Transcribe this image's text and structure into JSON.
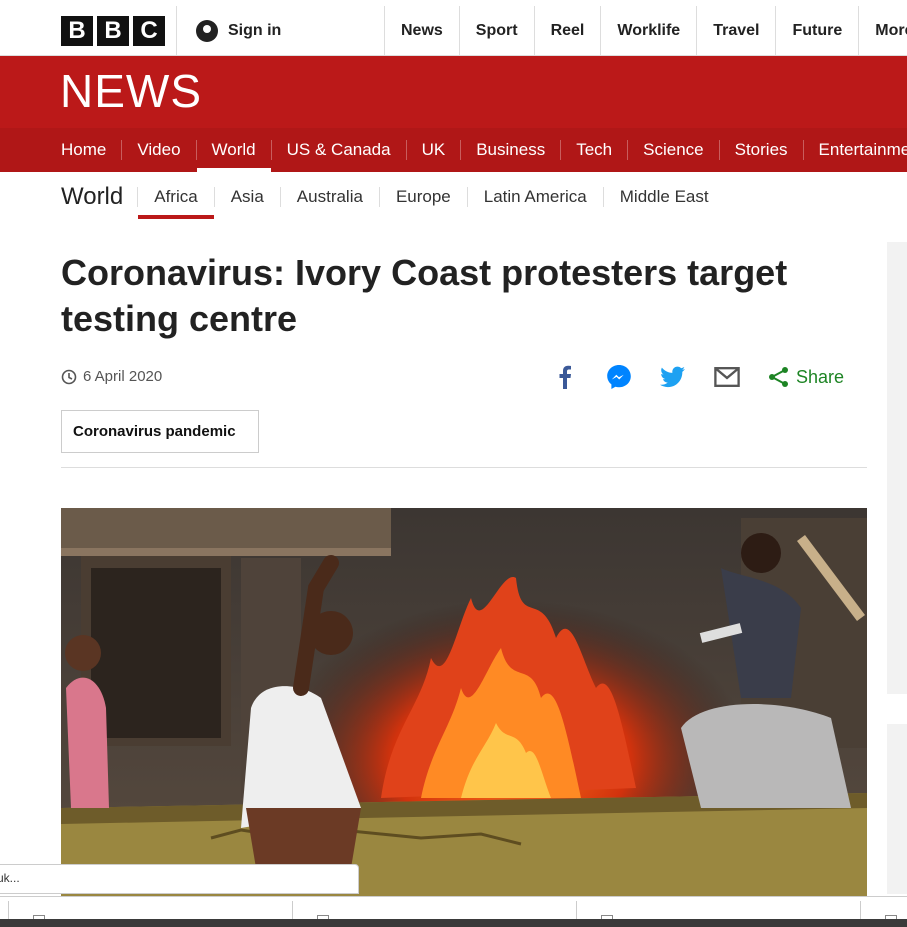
{
  "header": {
    "logo_letters": [
      "B",
      "B",
      "C"
    ],
    "sign_in": "Sign in",
    "nav": [
      "News",
      "Sport",
      "Reel",
      "Worklife",
      "Travel",
      "Future",
      "More"
    ]
  },
  "news_banner": {
    "title": "NEWS"
  },
  "section_nav": {
    "items": [
      "Home",
      "Video",
      "World",
      "US & Canada",
      "UK",
      "Business",
      "Tech",
      "Science",
      "Stories",
      "Entertainment"
    ],
    "active": "World"
  },
  "sub_nav": {
    "title": "World",
    "items": [
      "Africa",
      "Asia",
      "Australia",
      "Europe",
      "Latin America",
      "Middle East"
    ],
    "active": "Africa"
  },
  "article": {
    "headline": "Coronavirus: Ivory Coast protesters target testing centre",
    "date": "6 April 2020",
    "tag": "Coronavirus pandemic",
    "share_label": "Share"
  },
  "status_url": "uk...",
  "colors": {
    "brand_red": "#bb1919",
    "share_green": "#1d8424",
    "facebook": "#3b5998",
    "messenger": "#0084ff",
    "twitter": "#1da1f2"
  },
  "icons": [
    "avatar-icon",
    "clock-icon",
    "facebook-icon",
    "messenger-icon",
    "twitter-icon",
    "email-icon",
    "share-icon"
  ]
}
